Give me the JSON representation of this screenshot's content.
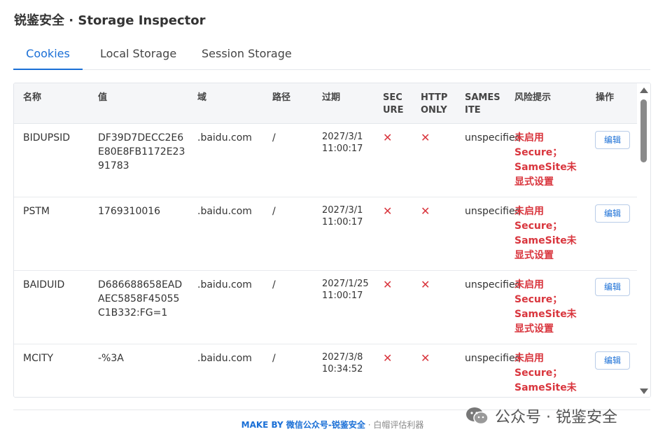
{
  "app": {
    "title": "锐鉴安全 · Storage Inspector"
  },
  "tabs": [
    {
      "label": "Cookies",
      "active": true
    },
    {
      "label": "Local Storage",
      "active": false
    },
    {
      "label": "Session Storage",
      "active": false
    }
  ],
  "table": {
    "headers": {
      "name": "名称",
      "value": "值",
      "domain": "域",
      "path": "路径",
      "expires": "过期",
      "secure": "SEC URE",
      "httponly": "HTTP ONLY",
      "samesite": "SAMES ITE",
      "risk": "风险提示",
      "action": "操作"
    },
    "rows": [
      {
        "name": "BIDUPSID",
        "value": "DF39D7DECC2E6E80E8FB1172E2391783",
        "domain": ".baidu.com",
        "path": "/",
        "expires": "2027/3/1 11:00:17",
        "secure": "✕",
        "httponly": "✕",
        "samesite": "unspecified",
        "risk": "未启用Secure；SameSite未显式设置",
        "action": "编辑"
      },
      {
        "name": "PSTM",
        "value": "1769310016",
        "domain": ".baidu.com",
        "path": "/",
        "expires": "2027/3/1 11:00:17",
        "secure": "✕",
        "httponly": "✕",
        "samesite": "unspecified",
        "risk": "未启用Secure；SameSite未显式设置",
        "action": "编辑"
      },
      {
        "name": "BAIDUID",
        "value": "D686688658EADAEC5858F45055C1B332:FG=1",
        "domain": ".baidu.com",
        "path": "/",
        "expires": "2027/1/25 11:00:17",
        "secure": "✕",
        "httponly": "✕",
        "samesite": "unspecified",
        "risk": "未启用Secure；SameSite未显式设置",
        "action": "编辑"
      },
      {
        "name": "MCITY",
        "value": "-%3A",
        "domain": ".baidu.com",
        "path": "/",
        "expires": "2027/3/8 10:34:52",
        "secure": "✕",
        "httponly": "✕",
        "samesite": "unspecified",
        "risk": "未启用Secure；SameSite未",
        "action": "编辑"
      }
    ]
  },
  "footer": {
    "make": "MAKE BY 微信公众号-锐鉴安全",
    "sub": " · 白帽评估利器"
  },
  "watermark": {
    "text": "公众号 · 锐鉴安全",
    "icon": "wechat-icon"
  },
  "colors": {
    "accent": "#1a6fd6",
    "danger": "#d9363e"
  }
}
